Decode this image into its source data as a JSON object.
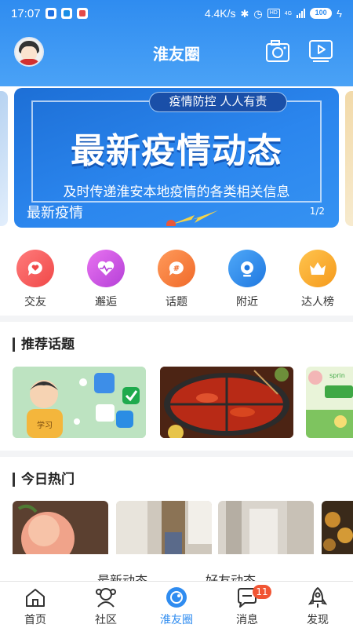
{
  "status_bar": {
    "time": "17:07",
    "network_speed": "4.4K/s",
    "hd_label": "HD",
    "network_type": "4G",
    "battery": "100"
  },
  "header": {
    "title": "淮友圈",
    "left_icon": "avatar",
    "right_icons": [
      "camera-icon",
      "video-icon"
    ]
  },
  "banner": {
    "tag": "疫情防控 人人有责",
    "headline": "最新疫情动态",
    "subtitle": "及时传递淮安本地疫情的各类相关信息",
    "caption": "最新疫情",
    "counter": "1/2"
  },
  "quick_links": [
    {
      "label": "交友",
      "icon": "heart-chat-icon",
      "color": "#f25a5a"
    },
    {
      "label": "邂逅",
      "icon": "heartbeat-icon",
      "color": "#c94fe0"
    },
    {
      "label": "话题",
      "icon": "hashtag-icon",
      "color": "#f47a3c"
    },
    {
      "label": "附近",
      "icon": "location-icon",
      "color": "#2f8cf0"
    },
    {
      "label": "达人榜",
      "icon": "crown-icon",
      "color": "#f6a623"
    }
  ],
  "sections": {
    "recommended": {
      "title": "推荐话题",
      "cards": [
        "cartoon-boy-image",
        "hotpot-image",
        "spring-image"
      ]
    },
    "hot_today": {
      "title": "今日热门",
      "cards": [
        "peach-image",
        "room-image",
        "wall-image",
        "food-image"
      ]
    }
  },
  "feed_tabs": [
    "最新动态",
    "好友动态"
  ],
  "bottom_nav": [
    {
      "label": "首页",
      "icon": "home-icon",
      "active": false
    },
    {
      "label": "社区",
      "icon": "community-icon",
      "active": false
    },
    {
      "label": "淮友圈",
      "icon": "circle-icon",
      "active": true
    },
    {
      "label": "消息",
      "icon": "message-icon",
      "active": false,
      "badge": "11"
    },
    {
      "label": "发现",
      "icon": "rocket-icon",
      "active": false
    }
  ],
  "colors": {
    "brand_blue": "#2f8cf0",
    "badge_red": "#f15533"
  }
}
